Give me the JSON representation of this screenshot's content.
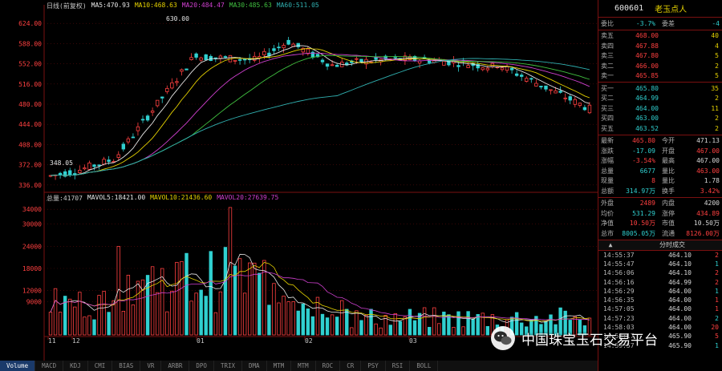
{
  "chart_legend": {
    "label": "日线(前复权)",
    "ma5": "MA5:470.93",
    "ma10": "MA10:468.63",
    "ma20": "MA20:484.47",
    "ma30": "MA30:485.63",
    "ma60": "MA60:511.05"
  },
  "volume_legend": {
    "label": "总量:41707",
    "mavol5": "MAVOL5:18421.00",
    "mavol10": "MAVOL10:21436.60",
    "mavol20": "MAVOL20:27639.75"
  },
  "price_axis": [
    "624.00",
    "588.00",
    "552.00",
    "516.00",
    "480.00",
    "444.00",
    "408.00",
    "372.00",
    "336.00"
  ],
  "volume_axis": [
    "34000",
    "30000",
    "24000",
    "18000",
    "12000",
    "9000"
  ],
  "annotations": {
    "high": "630.00",
    "low": "348.05"
  },
  "x_axis": [
    "11",
    "12",
    "01",
    "02",
    "03"
  ],
  "bottom_indicators": [
    "Volume",
    "MACD",
    "KDJ",
    "CMI",
    "BIAS",
    "VR",
    "ARBR",
    "DPO",
    "TRIX",
    "DMA",
    "MTM",
    "MTM",
    "ROC",
    "CR",
    "PSY",
    "RSI",
    "BOLL"
  ],
  "quote": {
    "code": "600601",
    "name": "老玉点人",
    "ratio": {
      "l": "委比",
      "v": "-3.7%",
      "l2": "委差",
      "v2": "-4"
    },
    "asks": [
      {
        "l": "卖五",
        "p": "468.00",
        "v": "40"
      },
      {
        "l": "卖四",
        "p": "467.88",
        "v": "4"
      },
      {
        "l": "卖三",
        "p": "467.80",
        "v": "5"
      },
      {
        "l": "卖二",
        "p": "466.00",
        "v": "2"
      },
      {
        "l": "卖一",
        "p": "465.85",
        "v": "5"
      }
    ],
    "bids": [
      {
        "l": "买一",
        "p": "465.80",
        "v": "35"
      },
      {
        "l": "买二",
        "p": "464.99",
        "v": "2"
      },
      {
        "l": "买三",
        "p": "464.00",
        "v": "11"
      },
      {
        "l": "买四",
        "p": "463.00",
        "v": "2"
      },
      {
        "l": "买五",
        "p": "463.52",
        "v": "2"
      }
    ],
    "stats": [
      {
        "l": "最新",
        "v": "465.80",
        "l2": "今开",
        "v2": "471.13"
      },
      {
        "l": "涨跌",
        "v": "-17.09",
        "l2": "开盘",
        "v2": "467.00"
      },
      {
        "l": "涨幅",
        "v": "-3.54%",
        "l2": "最高",
        "v2": "467.00"
      },
      {
        "l": "总量",
        "v": "6677",
        "l2": "量比",
        "v2": "463.00"
      },
      {
        "l": "现量",
        "v": "8",
        "l2": "量比",
        "v2": "1.78"
      },
      {
        "l": "总额",
        "v": "314.97万",
        "l2": "换手",
        "v2": "3.42%"
      }
    ],
    "stats2": [
      {
        "l": "外盘",
        "v": "2489",
        "l2": "内盘",
        "v2": "4200"
      },
      {
        "l": "均价",
        "v": "531.29",
        "l2": "涨停",
        "v2": "434.89"
      },
      {
        "l": "净值",
        "v": "10.50万",
        "l2": "市值",
        "v2": "10.50万"
      },
      {
        "l": "总市",
        "v": "8005.05万",
        "l2": "流通",
        "v2": "8126.00万"
      }
    ],
    "tab_label": "分时成交",
    "ticks": [
      {
        "t": "14:55:37",
        "p": "464.10",
        "v": "2"
      },
      {
        "t": "14:55:47",
        "p": "464.10",
        "v": "1"
      },
      {
        "t": "14:56:06",
        "p": "464.10",
        "v": "2"
      },
      {
        "t": "14:56:16",
        "p": "464.99",
        "v": "2"
      },
      {
        "t": "14:56:29",
        "p": "464.00",
        "v": "1"
      },
      {
        "t": "14:56:35",
        "p": "464.00",
        "v": "1"
      },
      {
        "t": "14:57:05",
        "p": "464.00",
        "v": "1"
      },
      {
        "t": "14:57:23",
        "p": "464.00",
        "v": "2"
      },
      {
        "t": "14:58:03",
        "p": "464.00",
        "v": "20"
      },
      {
        "t": "14:58:17",
        "p": "465.90",
        "v": "5"
      },
      {
        "t": "14:59:57",
        "p": "465.90",
        "v": "1"
      }
    ]
  },
  "watermark": "中国珠宝玉石交易平台",
  "colors": {
    "up": "#ff4040",
    "down": "#30d0d0",
    "ma5": "#e6e6e6",
    "ma10": "#e6d200",
    "ma20": "#d040d0",
    "ma30": "#40c040",
    "ma60": "#30b0b0"
  }
}
